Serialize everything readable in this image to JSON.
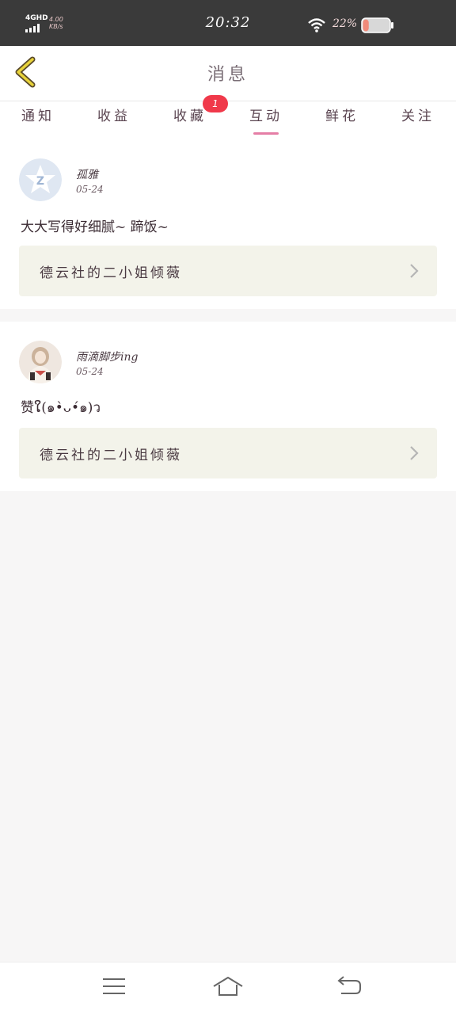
{
  "status_bar": {
    "network": "4GHD",
    "speed": "4.00",
    "speed_unit": "KB/s",
    "time": "20:32",
    "battery": "22%",
    "battery_level": 0.22,
    "icons": [
      "signal-icon",
      "wifi-icon",
      "battery-icon"
    ]
  },
  "header": {
    "title": "消息",
    "back_icon": "chevron-left-icon"
  },
  "tabs": [
    {
      "label": "通知"
    },
    {
      "label": "收益"
    },
    {
      "label": "收藏"
    },
    {
      "label": "互动",
      "active": true
    },
    {
      "label": "鲜花"
    },
    {
      "label": "关注"
    }
  ],
  "badge": "1",
  "messages": [
    {
      "username": "孤雅",
      "date": "05-24",
      "comment": "大大写得好细腻~ 蹄饭~",
      "ref_title": "德云社的二小姐倾薇"
    },
    {
      "username": "雨滴脚步ing",
      "date": "05-24",
      "comment": "赞ໃ(๑•̀ᴗ•́๑)ว",
      "ref_title": "德云社的二小姐倾薇"
    }
  ],
  "colors": {
    "accent": "#e57ea6",
    "badge": "#f0394a",
    "back_arrow": "#e8d33a",
    "status_bar": "#3a3a3a"
  },
  "navbar": {
    "icons": [
      "menu-icon",
      "home-icon",
      "back-icon"
    ]
  }
}
